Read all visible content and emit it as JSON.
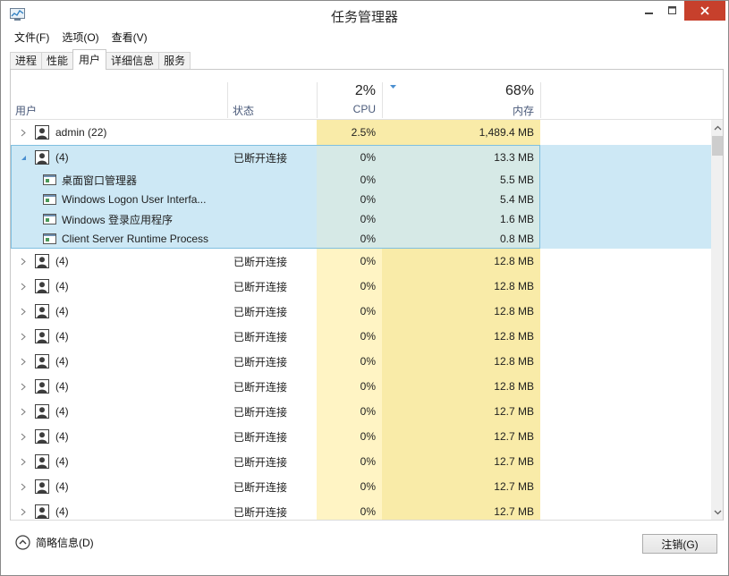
{
  "window": {
    "title": "任务管理器"
  },
  "menu": [
    "文件(F)",
    "选项(O)",
    "查看(V)"
  ],
  "tabs": [
    "进程",
    "性能",
    "用户",
    "详细信息",
    "服务"
  ],
  "active_tab": "用户",
  "columns": {
    "user": "用户",
    "status": "状态",
    "cpu_pct": "2%",
    "cpu_label": "CPU",
    "mem_pct": "68%",
    "mem_label": "内存"
  },
  "rows": [
    {
      "kind": "user",
      "expander": "collapsed",
      "name": "admin (22)",
      "status": "",
      "cpu": "2.5%",
      "mem": "1,489.4 MB"
    },
    {
      "kind": "user",
      "expander": "expanded",
      "name": "(4)",
      "status": "已断开连接",
      "cpu": "0%",
      "mem": "13.3 MB"
    },
    {
      "kind": "proc",
      "name": "桌面窗口管理器",
      "status": "",
      "cpu": "0%",
      "mem": "5.5 MB"
    },
    {
      "kind": "proc",
      "name": "Windows Logon User Interfa...",
      "status": "",
      "cpu": "0%",
      "mem": "5.4 MB"
    },
    {
      "kind": "proc",
      "name": "Windows 登录应用程序",
      "status": "",
      "cpu": "0%",
      "mem": "1.6 MB"
    },
    {
      "kind": "proc",
      "name": "Client Server Runtime Process",
      "status": "",
      "cpu": "0%",
      "mem": "0.8 MB"
    },
    {
      "kind": "user",
      "expander": "collapsed",
      "name": "(4)",
      "status": "已断开连接",
      "cpu": "0%",
      "mem": "12.8 MB"
    },
    {
      "kind": "user",
      "expander": "collapsed",
      "name": "(4)",
      "status": "已断开连接",
      "cpu": "0%",
      "mem": "12.8 MB"
    },
    {
      "kind": "user",
      "expander": "collapsed",
      "name": "(4)",
      "status": "已断开连接",
      "cpu": "0%",
      "mem": "12.8 MB"
    },
    {
      "kind": "user",
      "expander": "collapsed",
      "name": "(4)",
      "status": "已断开连接",
      "cpu": "0%",
      "mem": "12.8 MB"
    },
    {
      "kind": "user",
      "expander": "collapsed",
      "name": "(4)",
      "status": "已断开连接",
      "cpu": "0%",
      "mem": "12.8 MB"
    },
    {
      "kind": "user",
      "expander": "collapsed",
      "name": "(4)",
      "status": "已断开连接",
      "cpu": "0%",
      "mem": "12.8 MB"
    },
    {
      "kind": "user",
      "expander": "collapsed",
      "name": "(4)",
      "status": "已断开连接",
      "cpu": "0%",
      "mem": "12.7 MB"
    },
    {
      "kind": "user",
      "expander": "collapsed",
      "name": "(4)",
      "status": "已断开连接",
      "cpu": "0%",
      "mem": "12.7 MB"
    },
    {
      "kind": "user",
      "expander": "collapsed",
      "name": "(4)",
      "status": "已断开连接",
      "cpu": "0%",
      "mem": "12.7 MB"
    },
    {
      "kind": "user",
      "expander": "collapsed",
      "name": "(4)",
      "status": "已断开连接",
      "cpu": "0%",
      "mem": "12.7 MB"
    },
    {
      "kind": "user",
      "expander": "collapsed",
      "name": "(4)",
      "status": "已断开连接",
      "cpu": "0%",
      "mem": "12.7 MB"
    }
  ],
  "selected_group": 1,
  "footer": {
    "fewer_details": "简略信息(D)",
    "logoff": "注销(G)"
  },
  "colors": {
    "cpu_bg": "#fff4c4",
    "mem_bg": "#f9eba8",
    "first_cpu_bg": "#f9eba8",
    "first_mem_bg": "#f9eba8",
    "selected_bg": "#cde8f5",
    "selected_cpu_mem_bg": "#d6e9e6",
    "close_button": "#c7402c"
  },
  "icons": {
    "app": "task-manager-icon",
    "user": "user-icon",
    "process": "window-process-icon",
    "expand_collapsed": "chevron-right-icon",
    "expand_expanded": "chevron-down-icon",
    "sort": "sort-descending-icon",
    "fewer": "collapse-up-icon"
  }
}
